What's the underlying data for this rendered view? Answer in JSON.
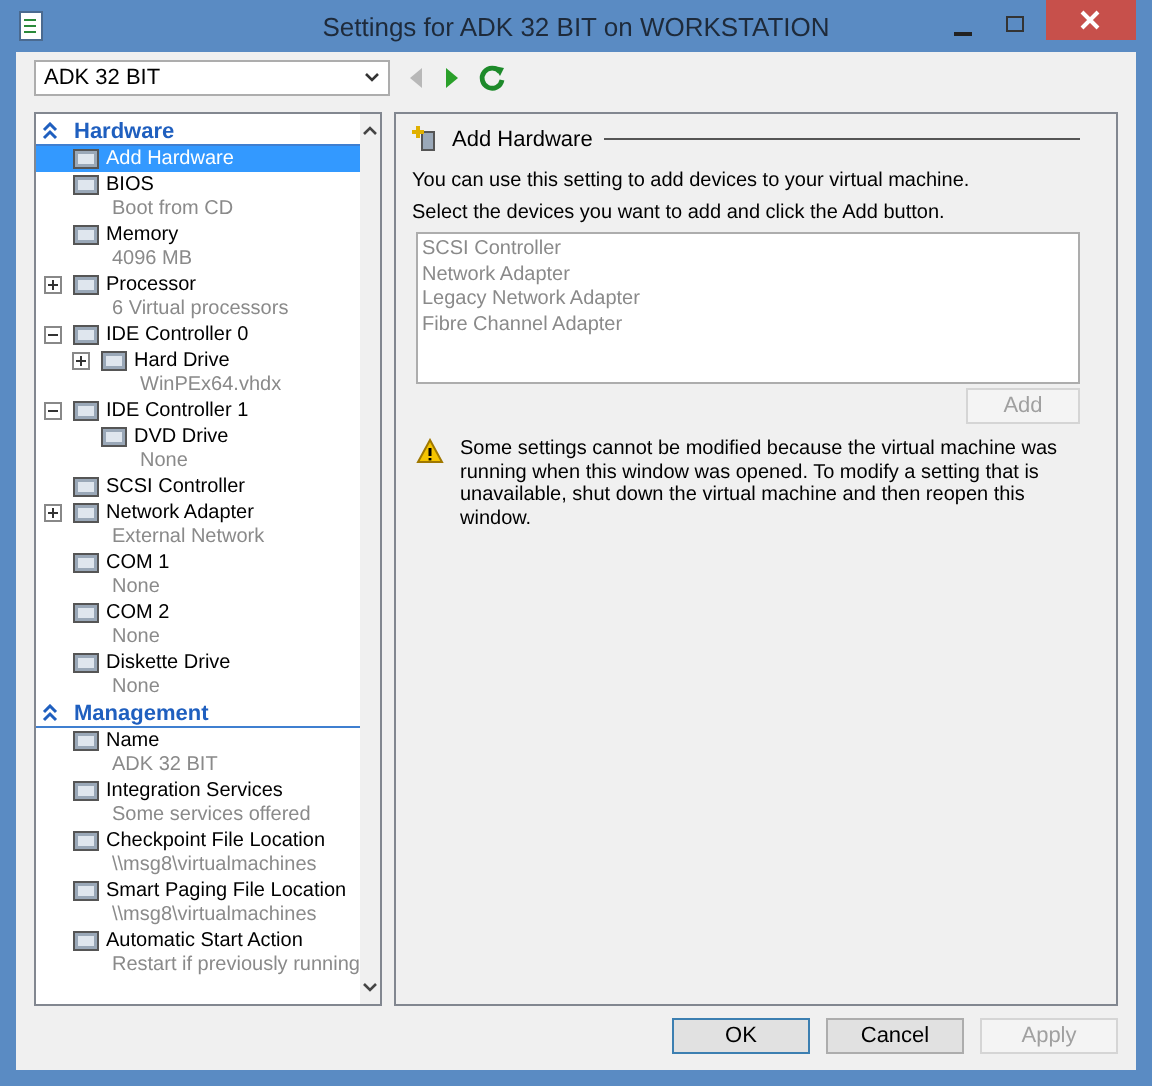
{
  "window": {
    "title": "Settings for ADK 32 BIT on WORKSTATION"
  },
  "toolbar": {
    "vm_select": "ADK 32 BIT",
    "back_disabled": true,
    "forward_disabled": false
  },
  "sections": [
    {
      "title": "Hardware",
      "items": [
        {
          "label": "Add Hardware",
          "selected": true
        },
        {
          "label": "BIOS",
          "detail": "Boot from CD",
          "selected": false
        },
        {
          "label": "Memory",
          "detail": "4096 MB",
          "selected": false
        },
        {
          "label": "Processor",
          "detail": "6 Virtual processors",
          "expanded": false,
          "selected": false
        },
        {
          "label": "IDE Controller 0",
          "expanded": true,
          "selected": false,
          "children": [
            {
              "label": "Hard Drive",
              "detail": "WinPEx64.vhdx",
              "expanded": false,
              "selected": false
            }
          ]
        },
        {
          "label": "IDE Controller 1",
          "expanded": true,
          "selected": false,
          "children": [
            {
              "label": "DVD Drive",
              "detail": "None",
              "selected": false
            }
          ]
        },
        {
          "label": "SCSI Controller",
          "selected": false
        },
        {
          "label": "Network Adapter",
          "detail": "External Network",
          "expanded": false,
          "selected": false
        },
        {
          "label": "COM 1",
          "detail": "None",
          "selected": false
        },
        {
          "label": "COM 2",
          "detail": "None",
          "selected": false
        },
        {
          "label": "Diskette Drive",
          "detail": "None",
          "selected": false
        }
      ]
    },
    {
      "title": "Management",
      "items": [
        {
          "label": "Name",
          "detail": "ADK 32 BIT",
          "selected": false
        },
        {
          "label": "Integration Services",
          "detail": "Some services offered",
          "selected": false
        },
        {
          "label": "Checkpoint File Location",
          "detail": "\\\\msg8\\virtualmachines",
          "selected": false
        },
        {
          "label": "Smart Paging File Location",
          "detail": "\\\\msg8\\virtualmachines",
          "selected": false
        },
        {
          "label": "Automatic Start Action",
          "detail": "Restart if previously running",
          "selected": false
        }
      ]
    }
  ],
  "panel": {
    "heading": "Add Hardware",
    "intro": "You can use this setting to add devices to your virtual machine.",
    "instruction": "Select the devices you want to add and click the Add button.",
    "devices": [
      "SCSI Controller",
      "Network Adapter",
      "Legacy Network Adapter",
      "Fibre Channel Adapter"
    ],
    "devices_disabled": true,
    "add_button": {
      "label": "Add",
      "disabled": true
    },
    "warning": "Some settings cannot be modified because the virtual machine was running when this window was opened. To modify a setting that is unavailable, shut down the virtual machine and then reopen this window."
  },
  "buttons": [
    {
      "label": "OK",
      "disabled": false,
      "focused": true
    },
    {
      "label": "Cancel",
      "disabled": false,
      "focused": false
    },
    {
      "label": "Apply",
      "disabled": true,
      "focused": false
    }
  ]
}
